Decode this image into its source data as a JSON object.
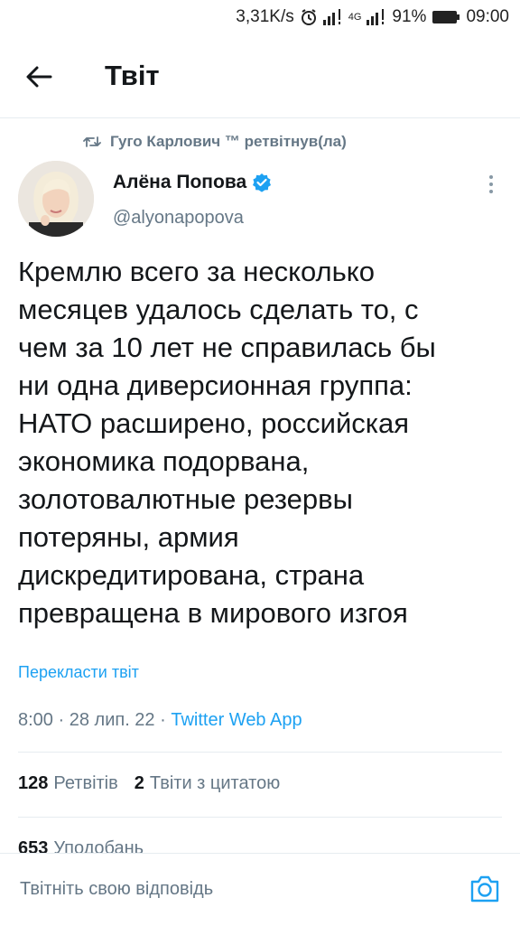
{
  "status_bar": {
    "speed": "3,31K/s",
    "network": "4G",
    "battery": "91%",
    "time": "09:00"
  },
  "header": {
    "title": "Твіт"
  },
  "retweet": {
    "text": "Гуго Карлович ™ ретвітнув(ла)"
  },
  "author": {
    "name": "Алёна Попова",
    "handle": "@alyonapopova",
    "verified": true
  },
  "tweet": {
    "lines": [
      "Кремлю всего за несколько",
      "месяцев удалось сделать то, с",
      "чем за 10 лет не справилась бы",
      "ни одна диверсионная группа:",
      "НАТО расширено, российская",
      "экономика подорвана,",
      "золотовалютные резервы",
      "потеряны, армия",
      "дискредитирована, страна",
      "превращена в мирового изгоя"
    ],
    "translate_label": "Перекласти твіт",
    "time": "8:00",
    "date": "28 лип. 22",
    "source": "Twitter Web App"
  },
  "stats": {
    "retweets_count": "128",
    "retweets_label": "Ретвітів",
    "quotes_count": "2",
    "quotes_label": "Твіти з цитатою",
    "likes_count": "653",
    "likes_label": "Уподобань"
  },
  "reply": {
    "placeholder": "Твітніть свою відповідь"
  },
  "colors": {
    "accent": "#1da1f2",
    "secondary_text": "#657786",
    "primary_text": "#14171a"
  },
  "icons": {
    "back": "arrow-left-icon",
    "retweet": "retweet-icon",
    "verified": "verified-badge-icon",
    "more": "more-vertical-icon",
    "camera": "camera-icon"
  }
}
